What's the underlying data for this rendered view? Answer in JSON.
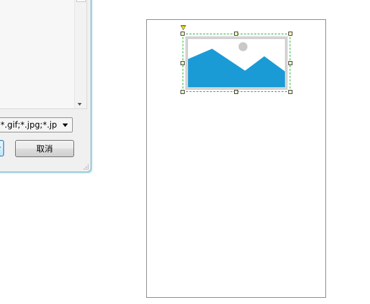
{
  "dialog": {
    "file_type_filter": "s (*.gif;*.jpg;*.jp",
    "cancel_label": "取消"
  },
  "canvas": {
    "image_widget": {
      "icon": "image-placeholder-icon",
      "colors": {
        "mountains": "#1a9bd6",
        "sun": "#c8c8c8",
        "frame": "#d3d3d3",
        "selection_border": "#27b43c",
        "handle_fill": "#ffffc0"
      }
    }
  }
}
